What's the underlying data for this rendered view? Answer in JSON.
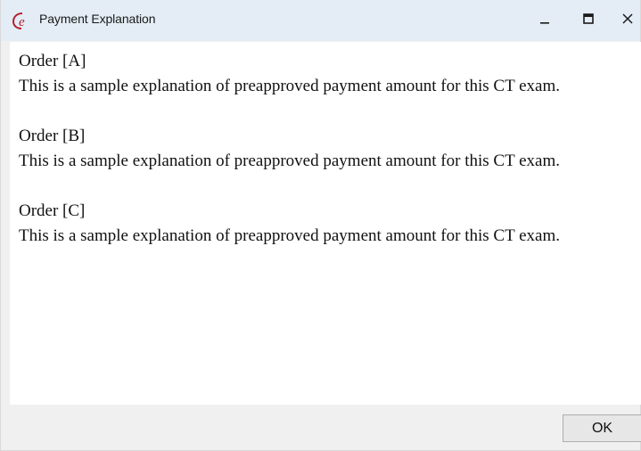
{
  "window": {
    "title": "Payment Explanation",
    "app_icon": "app-logo-icon",
    "controls": {
      "minimize_icon": "minimize-icon",
      "maximize_icon": "maximize-icon",
      "close_icon": "close-icon"
    },
    "colors": {
      "titlebar": "#e4edf5",
      "frame": "#f0f0f0",
      "content": "#ffffff",
      "icon_red": "#b51f2e"
    }
  },
  "content": {
    "orders": [
      {
        "title": "Order [A]",
        "description": "This is a sample explanation of preapproved payment amount for this CT exam."
      },
      {
        "title": "Order [B]",
        "description": "This is a sample explanation of preapproved payment amount for this CT exam."
      },
      {
        "title": "Order [C]",
        "description": "This is a sample explanation of preapproved payment amount for this CT exam."
      }
    ]
  },
  "footer": {
    "ok_label": "OK"
  }
}
